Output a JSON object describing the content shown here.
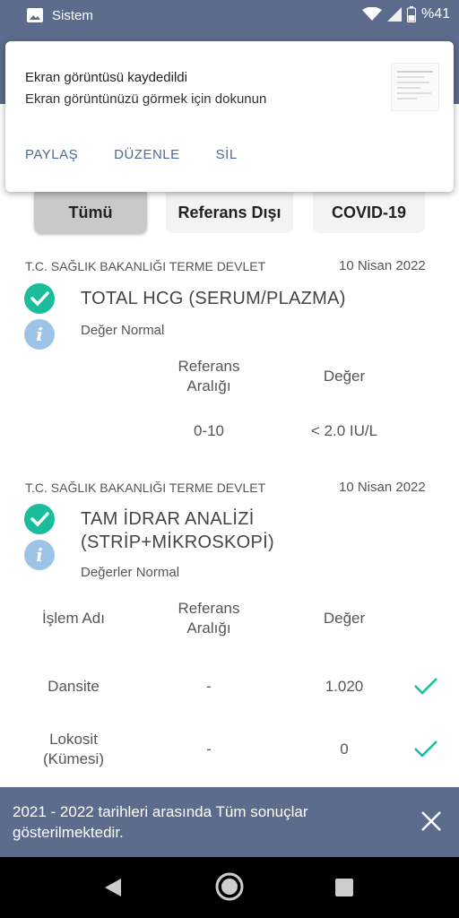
{
  "status_bar": {
    "app_name": "Sistem",
    "battery": "%41"
  },
  "notification": {
    "title": "Ekran görüntüsü kaydedildi",
    "subtitle": "Ekran görüntünüzü görmek için dokunun",
    "actions": [
      "PAYLAŞ",
      "DÜZENLE",
      "SİL"
    ]
  },
  "tabs": [
    {
      "label": "Tümü",
      "active": true
    },
    {
      "label": "Referans Dışı",
      "active": false
    },
    {
      "label": "COVID-19",
      "active": false
    }
  ],
  "results": [
    {
      "source": "T.C. SAĞLIK BAKANLIĞI TERME DEVLET",
      "date": "10 Nisan 2022",
      "test_name": "TOTAL HCG (SERUM/PLAZMA)",
      "status": "Değer Normal",
      "headers": {
        "reference_line1": "Referans",
        "reference_line2": "Aralığı",
        "value": "Değer"
      },
      "row": {
        "reference": "0-10",
        "value": "< 2.0 IU/L"
      }
    },
    {
      "source": "T.C. SAĞLIK BAKANLIĞI TERME DEVLET",
      "date": "10 Nisan 2022",
      "test_name_line1": "TAM İDRAR ANALİZİ",
      "test_name_line2": "(STRİP+MİKROSKOPİ)",
      "status": "Değerler Normal",
      "headers": {
        "name": "İşlem Adı",
        "reference_line1": "Referans",
        "reference_line2": "Aralığı",
        "value": "Değer"
      },
      "rows": [
        {
          "name_line1": "Dansite",
          "name_line2": "",
          "reference": "-",
          "value": "1.020"
        },
        {
          "name_line1": "Lokosit",
          "name_line2": "(Kümesi)",
          "reference": "-",
          "value": "0"
        }
      ]
    }
  ],
  "snackbar": {
    "text": "2021 - 2022 tarihleri arasında Tüm sonuçlar gösterilmektedir."
  },
  "colors": {
    "header": "#5d6b8c",
    "check": "#1abc9c",
    "info": "#9dc3e6",
    "action": "#4b6b99"
  }
}
